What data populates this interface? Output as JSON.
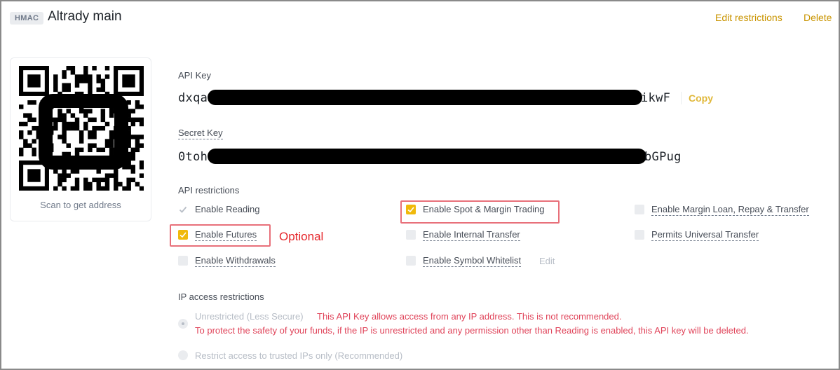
{
  "header": {
    "badge": "HMAC",
    "title": "Altrady main",
    "edit_restrictions": "Edit restrictions",
    "delete": "Delete"
  },
  "qr": {
    "caption": "Scan to get address"
  },
  "api_key": {
    "label": "API Key",
    "prefix": "dxqa",
    "suffix": "ikwF",
    "copy": "Copy"
  },
  "secret_key": {
    "label": "Secret Key",
    "prefix": "0toh",
    "suffix": "bGPug"
  },
  "restrictions": {
    "label": "API restrictions",
    "enable_reading": "Enable Reading",
    "enable_spot_margin": "Enable Spot & Margin Trading",
    "enable_margin_loan": "Enable Margin Loan, Repay & Transfer",
    "enable_futures": "Enable Futures",
    "enable_internal_transfer": "Enable Internal Transfer",
    "permits_universal_transfer": "Permits Universal Transfer",
    "enable_withdrawals": "Enable Withdrawals",
    "enable_symbol_whitelist": "Enable Symbol Whitelist",
    "edit": "Edit",
    "optional_note": "Optional"
  },
  "ip": {
    "label": "IP access restrictions",
    "unrestricted": "Unrestricted (Less Secure)",
    "warning_1": "This API Key allows access from any IP address. This is not recommended.",
    "warning_2": "To protect the safety of your funds, if the IP is unrestricted and any permission other than Reading is enabled, this API key will be deleted.",
    "restricted": "Restrict access to trusted IPs only (Recommended)"
  },
  "colors": {
    "accent": "#f0b90b",
    "link": "#c99400",
    "warning": "#e0445a",
    "highlight_box": "#e8707a",
    "annotation": "#e5252a"
  }
}
